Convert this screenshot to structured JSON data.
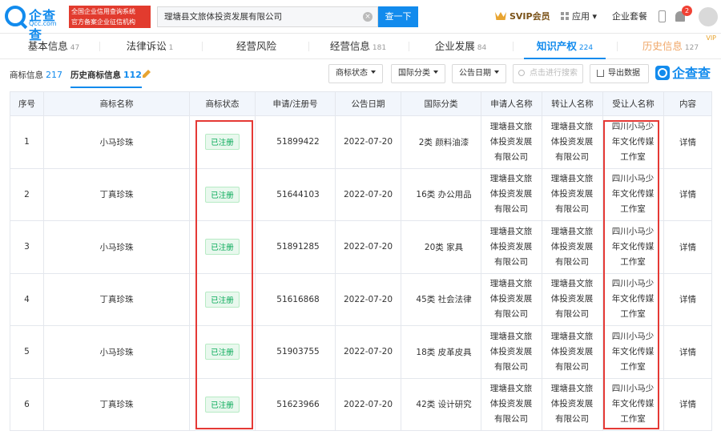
{
  "header": {
    "logo_text": "企查查",
    "logo_sub": "Qcc.com",
    "badge_lines": [
      "全国企业信用查询系统",
      "官方备案企业征信机构"
    ],
    "search_value": "理塘县文旅体投资发展有限公司",
    "search_clear": "×",
    "search_button": "查一下",
    "svip": "SVIP会员",
    "app": "应用",
    "enterprise": "企业套餐",
    "bell_count": "2"
  },
  "tabs": [
    {
      "label": "基本信息",
      "count": "47"
    },
    {
      "label": "法律诉讼",
      "count": "1"
    },
    {
      "label": "经营风险",
      "count": ""
    },
    {
      "label": "经营信息",
      "count": "181"
    },
    {
      "label": "企业发展",
      "count": "84"
    },
    {
      "label": "知识产权",
      "count": "224"
    },
    {
      "label": "历史信息",
      "count": "127",
      "tag": "VIP"
    }
  ],
  "subtabs": [
    {
      "label": "商标信息",
      "count": "217"
    },
    {
      "label": "历史商标信息",
      "count": "112"
    }
  ],
  "filters": {
    "status": "商标状态",
    "class": "国际分类",
    "date": "公告日期",
    "search_placeholder": "点击进行搜索",
    "export": "导出数据",
    "brand": "企查查"
  },
  "table": {
    "headers": [
      "序号",
      "商标名称",
      "商标状态",
      "申请/注册号",
      "公告日期",
      "国际分类",
      "申请人名称",
      "转让人名称",
      "受让人名称",
      "内容"
    ],
    "rows": [
      {
        "no": "1",
        "name": "小马珍珠",
        "status": "已注册",
        "reg": "51899422",
        "date": "2022-07-20",
        "cls": "2类 颜料油漆",
        "applicant": [
          "理塘县文旅",
          "体投资发展",
          "有限公司"
        ],
        "transferor": [
          "理塘县文旅",
          "体投资发展",
          "有限公司"
        ],
        "transferee": [
          "四川小马少",
          "年文化传媒",
          "工作室"
        ],
        "detail": "详情"
      },
      {
        "no": "2",
        "name": "丁真珍珠",
        "status": "已注册",
        "reg": "51644103",
        "date": "2022-07-20",
        "cls": "16类 办公用品",
        "applicant": [
          "理塘县文旅",
          "体投资发展",
          "有限公司"
        ],
        "transferor": [
          "理塘县文旅",
          "体投资发展",
          "有限公司"
        ],
        "transferee": [
          "四川小马少",
          "年文化传媒",
          "工作室"
        ],
        "detail": "详情"
      },
      {
        "no": "3",
        "name": "小马珍珠",
        "status": "已注册",
        "reg": "51891285",
        "date": "2022-07-20",
        "cls": "20类 家具",
        "applicant": [
          "理塘县文旅",
          "体投资发展",
          "有限公司"
        ],
        "transferor": [
          "理塘县文旅",
          "体投资发展",
          "有限公司"
        ],
        "transferee": [
          "四川小马少",
          "年文化传媒",
          "工作室"
        ],
        "detail": "详情"
      },
      {
        "no": "4",
        "name": "丁真珍珠",
        "status": "已注册",
        "reg": "51616868",
        "date": "2022-07-20",
        "cls": "45类 社会法律",
        "applicant": [
          "理塘县文旅",
          "体投资发展",
          "有限公司"
        ],
        "transferor": [
          "理塘县文旅",
          "体投资发展",
          "有限公司"
        ],
        "transferee": [
          "四川小马少",
          "年文化传媒",
          "工作室"
        ],
        "detail": "详情"
      },
      {
        "no": "5",
        "name": "小马珍珠",
        "status": "已注册",
        "reg": "51903755",
        "date": "2022-07-20",
        "cls": "18类 皮革皮具",
        "applicant": [
          "理塘县文旅",
          "体投资发展",
          "有限公司"
        ],
        "transferor": [
          "理塘县文旅",
          "体投资发展",
          "有限公司"
        ],
        "transferee": [
          "四川小马少",
          "年文化传媒",
          "工作室"
        ],
        "detail": "详情"
      },
      {
        "no": "6",
        "name": "丁真珍珠",
        "status": "已注册",
        "reg": "51623966",
        "date": "2022-07-20",
        "cls": "42类 设计研究",
        "applicant": [
          "理塘县文旅",
          "体投资发展",
          "有限公司"
        ],
        "transferor": [
          "理塘县文旅",
          "体投资发展",
          "有限公司"
        ],
        "transferee": [
          "四川小马少",
          "年文化传媒",
          "工作室"
        ],
        "detail": "详情"
      }
    ]
  },
  "colors": {
    "accent": "#128bed",
    "highlight": "#e53935",
    "status_green": "#00a854"
  }
}
